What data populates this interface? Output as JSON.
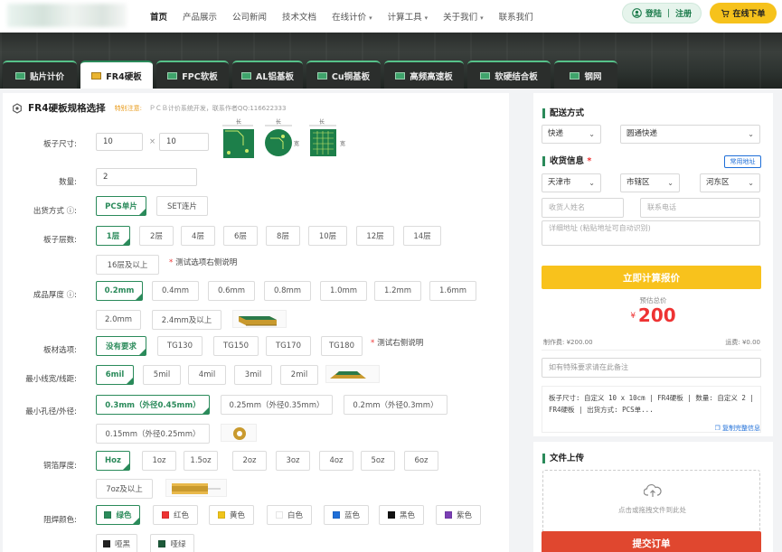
{
  "nav": {
    "items": [
      "首页",
      "产品展示",
      "公司新闻",
      "技术文档",
      "在线计价",
      "计算工具",
      "关于我们",
      "联系我们"
    ],
    "carets": [
      "",
      "",
      "",
      "",
      "▾",
      "▾",
      "▾",
      ""
    ],
    "login_label": "登陆 ｜ 注册",
    "order_label": "在线下单"
  },
  "tabs": [
    "贴片计价",
    "FR4硬板",
    "FPC软板",
    "AL铝基板",
    "Cu铜基板",
    "高频高速板",
    "软硬结合板",
    "钢网"
  ],
  "active_tab": 1,
  "left": {
    "title": "FR4硬板规格选择",
    "warn": "特别注意:",
    "warn_text": "ＰＣＢ计价系统开发，联系作者QQ:116622333",
    "size": {
      "label": "板子尺寸:",
      "w": "10",
      "h": "10",
      "x": "×"
    },
    "qty": {
      "label": "数量:",
      "value": "2"
    },
    "ship": {
      "label": "出货方式 ⓘ:",
      "options": [
        "PCS单片",
        "SET连片"
      ],
      "selected": 0
    },
    "layers": {
      "label": "板子层数:",
      "options": [
        "1层",
        "2层",
        "4层",
        "6层",
        "8层",
        "10层",
        "12层",
        "14层",
        "16层及以上"
      ],
      "selected": 0,
      "note": "测试选项右侧说明"
    },
    "thickness": {
      "label": "成品厚度 ⓘ:",
      "options": [
        "0.2mm",
        "0.4mm",
        "0.6mm",
        "0.8mm",
        "1.0mm",
        "1.2mm",
        "1.6mm",
        "2.0mm",
        "2.4mm及以上"
      ],
      "selected": 0
    },
    "material": {
      "label": "板材选项:",
      "options": [
        "没有要求",
        "TG130",
        "TG150",
        "TG170",
        "TG180"
      ],
      "selected": 0,
      "note": "测试右侧说明"
    },
    "trace": {
      "label": "最小线宽/线距:",
      "options": [
        "6mil",
        "5mil",
        "4mil",
        "3mil",
        "2mil"
      ],
      "selected": 0
    },
    "hole": {
      "label": "最小孔径/外径:",
      "options": [
        "0.3mm（外径0.45mm）",
        "0.25mm（外径0.35mm）",
        "0.2mm（外径0.3mm）",
        "0.15mm（外径0.25mm）"
      ],
      "selected": 0
    },
    "copper": {
      "label": "铜箔厚度:",
      "options": [
        "Hoz",
        "1oz",
        "1.5oz",
        "2oz",
        "3oz",
        "4oz",
        "5oz",
        "6oz",
        "7oz及以上"
      ],
      "selected": 0
    },
    "mask": {
      "label": "阻焊颜色:",
      "options": [
        {
          "t": "绿色",
          "c": "#2a8a5a"
        },
        {
          "t": "红色",
          "c": "#e33"
        },
        {
          "t": "黄色",
          "c": "#f0c419"
        },
        {
          "t": "白色",
          "c": "#ffffff"
        },
        {
          "t": "蓝色",
          "c": "#1f6fd8"
        },
        {
          "t": "黑色",
          "c": "#111111"
        },
        {
          "t": "紫色",
          "c": "#7b3fb5"
        },
        {
          "t": "哑黑",
          "c": "#222222"
        },
        {
          "t": "哑绿",
          "c": "#1d5a3a"
        }
      ],
      "selected": 0
    },
    "thumb_labels": {
      "len": "长",
      "width": "宽"
    }
  },
  "right": {
    "delivery_title": "配送方式",
    "delivery": [
      "快递",
      "圆通快递"
    ],
    "recv_title": "收货信息",
    "recv_req": "*",
    "common_addr": "常用地址",
    "region": [
      "天津市",
      "市辖区",
      "河东区"
    ],
    "name_ph": "收货人姓名",
    "phone_ph": "联系电话",
    "addr_ph": "详细地址 (粘贴地址可自动识别)",
    "calc_label": "立即计算报价",
    "est_label": "预估总价",
    "currency": "¥",
    "total": "200",
    "make_fee": "制作费: ¥200.00",
    "ship_fee": "运费: ¥0.00",
    "remark_ph": "如有特殊要求请在此备注",
    "summary": "板子尺寸: 自定义 10 x 10cm | FR4硬板 | 数量: 自定义 2 | FR4硬板 | 出货方式: PCS单...",
    "copy_label": "复制完整信息",
    "file_title": "文件上传",
    "upload_hint": "点击或拖拽文件到此处",
    "submit_label": "提交订单"
  }
}
